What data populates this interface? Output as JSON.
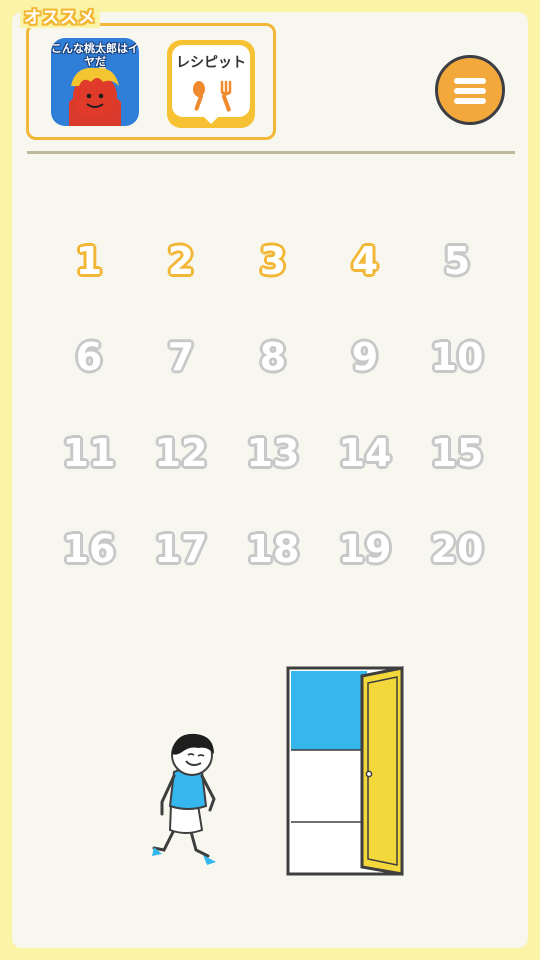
{
  "promo": {
    "title": "オススメ",
    "apps": [
      {
        "name": "こんな桃太郎はイヤだ",
        "icon": "oni-character-icon",
        "color": "#2f7ed8"
      },
      {
        "name": "レシピット",
        "icon": "spoon-fork-icon",
        "color": "#f6c234"
      }
    ]
  },
  "menu": {
    "icon": "hamburger-menu-icon",
    "color": "#f2a83a"
  },
  "levels": {
    "unlocked_color": "#f2b736",
    "locked_color": "#c8c8c8",
    "items": [
      {
        "label": "1",
        "unlocked": true
      },
      {
        "label": "2",
        "unlocked": true
      },
      {
        "label": "3",
        "unlocked": true
      },
      {
        "label": "4",
        "unlocked": true
      },
      {
        "label": "5",
        "unlocked": false
      },
      {
        "label": "6",
        "unlocked": false
      },
      {
        "label": "7",
        "unlocked": false
      },
      {
        "label": "8",
        "unlocked": false
      },
      {
        "label": "9",
        "unlocked": false
      },
      {
        "label": "10",
        "unlocked": false
      },
      {
        "label": "11",
        "unlocked": false
      },
      {
        "label": "12",
        "unlocked": false
      },
      {
        "label": "13",
        "unlocked": false
      },
      {
        "label": "14",
        "unlocked": false
      },
      {
        "label": "15",
        "unlocked": false
      },
      {
        "label": "16",
        "unlocked": false
      },
      {
        "label": "17",
        "unlocked": false
      },
      {
        "label": "18",
        "unlocked": false
      },
      {
        "label": "19",
        "unlocked": false
      },
      {
        "label": "20",
        "unlocked": false
      }
    ]
  },
  "scene": {
    "character": "walking-boy",
    "door": "open-yellow-door",
    "sky_color": "#35b7ee",
    "door_color": "#f3d83b"
  }
}
